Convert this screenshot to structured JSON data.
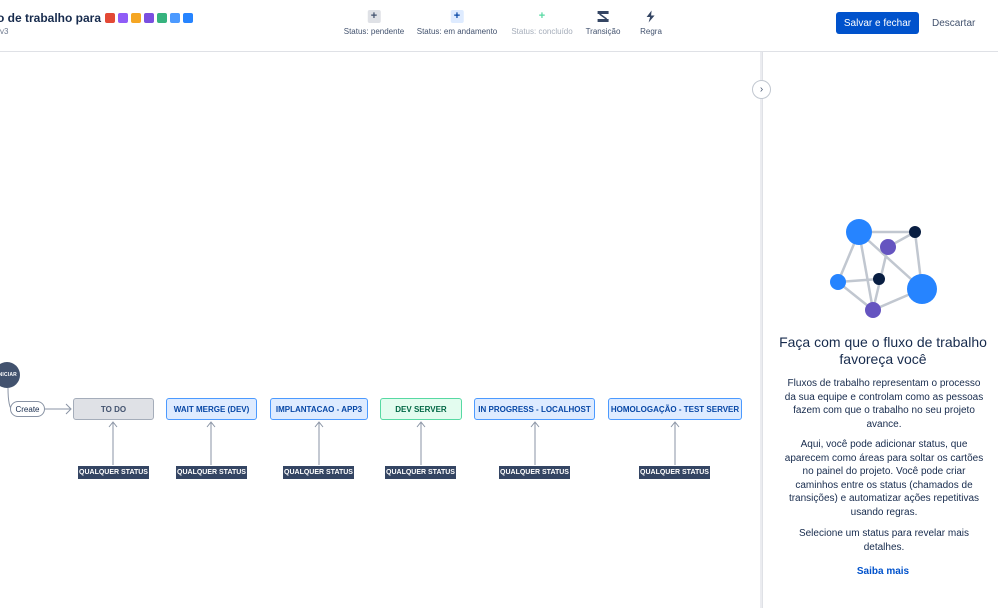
{
  "header": {
    "title": "o de trabalho para",
    "subtitle": "v3",
    "emoji_colors": [
      "#e34935",
      "#8f5cf7",
      "#f5a623",
      "#7a4fe0",
      "#36b37e",
      "#4c9aff",
      "#2684ff"
    ],
    "save_label": "Salvar e fechar",
    "discard_label": "Descartar"
  },
  "toolbar": {
    "items": [
      {
        "label": "Status: pendente",
        "icon": "plus-icon",
        "color": "#42526e",
        "bg": "#dfe1e6"
      },
      {
        "label": "Status: em andamento",
        "icon": "plus-icon",
        "color": "#0747a6",
        "bg": "#deebff"
      },
      {
        "label": "Status: concluído",
        "icon": "plus-icon",
        "color": "#57d9a3",
        "bg": "#ffffff"
      },
      {
        "label": "Transição",
        "icon": "transition-icon",
        "color": "#344563"
      },
      {
        "label": "Regra",
        "icon": "lightning-icon",
        "color": "#344563"
      }
    ]
  },
  "workflow": {
    "start_label": "INICIAR",
    "create_label": "Create",
    "statuses": [
      {
        "label": "TO DO",
        "category": "todo"
      },
      {
        "label": "WAIT MERGE (DEV)",
        "category": "prog"
      },
      {
        "label": "IMPLANTACAO - APP3",
        "category": "prog"
      },
      {
        "label": "DEV SERVER",
        "category": "done"
      },
      {
        "label": "IN PROGRESS - LOCALHOST",
        "category": "prog"
      },
      {
        "label": "HOMOLOGAÇÃO - TEST SERVER",
        "category": "prog"
      }
    ],
    "any_status_label": "QUALQUER STATUS"
  },
  "panel": {
    "title": "Faça com que o fluxo de trabalho favoreça você",
    "p1": "Fluxos de trabalho representam o processo da sua equipe e controlam como as pessoas fazem com que o trabalho no seu projeto avance.",
    "p2": "Aqui, você pode adicionar status, que aparecem como áreas para soltar os cartões no painel do projeto. Você pode criar caminhos entre os status (chamados de transições) e automatizar ações repetitivas usando regras.",
    "p3": "Selecione um status para revelar mais detalhes.",
    "link": "Saiba mais",
    "colors": {
      "blue": "#2684ff",
      "purple": "#6554c0",
      "navy": "#091e42"
    }
  }
}
